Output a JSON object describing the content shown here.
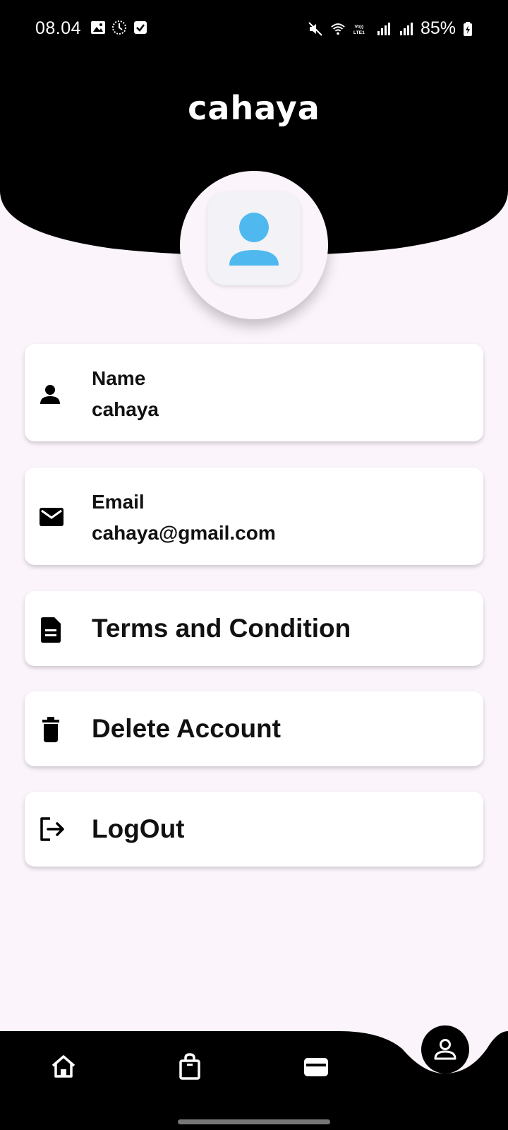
{
  "status_bar": {
    "time": "08.04",
    "battery": "85%"
  },
  "header": {
    "title": "cahaya"
  },
  "profile": {
    "name": {
      "label": "Name",
      "value": "cahaya"
    },
    "email": {
      "label": "Email",
      "value": "cahaya@gmail.com"
    }
  },
  "menu": {
    "terms": "Terms and Condition",
    "delete": "Delete Account",
    "logout": "LogOut"
  },
  "colors": {
    "header_bg": "#000000",
    "page_bg": "#fbf4fb",
    "avatar_accent": "#4fb9ef"
  },
  "icons": {
    "name": "person-icon",
    "email": "mail-icon",
    "terms": "document-icon",
    "delete": "trash-icon",
    "logout": "logout-icon",
    "nav": [
      "home-icon",
      "shopping-bag-icon",
      "wallet-icon",
      "profile-icon"
    ]
  }
}
